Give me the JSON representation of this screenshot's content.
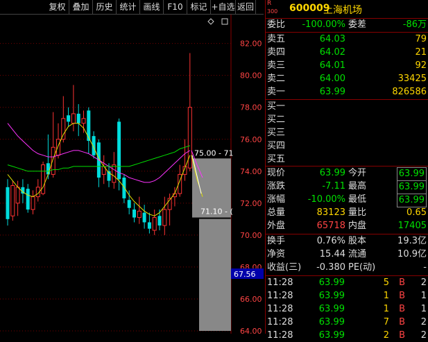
{
  "toolbar": {
    "buttons": [
      "复权",
      "叠加",
      "历史",
      "统计",
      "画线",
      "F10",
      "标记",
      "+自选",
      "返回"
    ]
  },
  "chart_data": {
    "type": "candlestick",
    "title": "",
    "yticks": [
      "82.00",
      "80.00",
      "78.00",
      "76.00",
      "74.00",
      "72.00",
      "70.00",
      "68.00",
      "66.00",
      "64.00"
    ],
    "ylim": [
      64,
      83.2
    ],
    "current_price_label": "67.56",
    "annotation_high": "75.00 - 71",
    "annotation_low": "71.10 - (",
    "candles": [
      {
        "o": 73.0,
        "c": 71.0,
        "h": 73.5,
        "l": 70.6
      },
      {
        "o": 71.2,
        "c": 73.1,
        "h": 73.4,
        "l": 70.9
      },
      {
        "o": 72.0,
        "c": 73.0,
        "h": 73.4,
        "l": 71.2
      },
      {
        "o": 73.0,
        "c": 72.6,
        "h": 73.5,
        "l": 72.0
      },
      {
        "o": 72.9,
        "c": 71.6,
        "h": 73.2,
        "l": 71.4
      },
      {
        "o": 71.6,
        "c": 72.4,
        "h": 72.8,
        "l": 71.3
      },
      {
        "o": 72.4,
        "c": 73.0,
        "h": 73.5,
        "l": 72.1
      },
      {
        "o": 72.6,
        "c": 74.4,
        "h": 74.6,
        "l": 72.5
      },
      {
        "o": 74.5,
        "c": 73.8,
        "h": 76.3,
        "l": 73.5
      },
      {
        "o": 73.8,
        "c": 75.5,
        "h": 77.7,
        "l": 73.6
      },
      {
        "o": 75.0,
        "c": 76.0,
        "h": 77.0,
        "l": 74.8
      },
      {
        "o": 76.0,
        "c": 77.3,
        "h": 78.7,
        "l": 75.8
      },
      {
        "o": 77.5,
        "c": 77.1,
        "h": 78.0,
        "l": 76.8
      },
      {
        "o": 77.0,
        "c": 77.6,
        "h": 79.4,
        "l": 76.5
      },
      {
        "o": 77.6,
        "c": 77.0,
        "h": 78.2,
        "l": 76.2
      },
      {
        "o": 77.0,
        "c": 77.3,
        "h": 77.8,
        "l": 76.4
      },
      {
        "o": 77.8,
        "c": 75.9,
        "h": 78.0,
        "l": 75.1
      },
      {
        "o": 76.2,
        "c": 75.0,
        "h": 76.5,
        "l": 74.8
      },
      {
        "o": 75.8,
        "c": 73.6,
        "h": 76.0,
        "l": 73.0
      },
      {
        "o": 73.8,
        "c": 74.3,
        "h": 75.0,
        "l": 73.2
      },
      {
        "o": 74.0,
        "c": 73.4,
        "h": 74.5,
        "l": 73.0
      },
      {
        "o": 73.3,
        "c": 74.4,
        "h": 75.2,
        "l": 72.9
      },
      {
        "o": 77.1,
        "c": 73.5,
        "h": 77.3,
        "l": 72.8
      },
      {
        "o": 73.6,
        "c": 72.3,
        "h": 73.8,
        "l": 72.0
      },
      {
        "o": 72.2,
        "c": 71.7,
        "h": 72.8,
        "l": 71.3
      },
      {
        "o": 71.6,
        "c": 71.1,
        "h": 72.0,
        "l": 70.8
      },
      {
        "o": 71.1,
        "c": 71.5,
        "h": 72.4,
        "l": 70.7
      },
      {
        "o": 71.4,
        "c": 70.8,
        "h": 71.9,
        "l": 70.4
      },
      {
        "o": 70.8,
        "c": 70.4,
        "h": 71.4,
        "l": 70.1
      },
      {
        "o": 70.3,
        "c": 71.1,
        "h": 71.6,
        "l": 70.0
      },
      {
        "o": 71.2,
        "c": 70.6,
        "h": 71.6,
        "l": 70.3
      },
      {
        "o": 70.6,
        "c": 71.6,
        "h": 72.4,
        "l": 70.0
      },
      {
        "o": 71.6,
        "c": 72.3,
        "h": 72.6,
        "l": 70.6
      },
      {
        "o": 72.4,
        "c": 72.6,
        "h": 73.0,
        "l": 71.8
      },
      {
        "o": 72.6,
        "c": 73.8,
        "h": 74.4,
        "l": 72.4
      },
      {
        "o": 73.8,
        "c": 74.3,
        "h": 76.0,
        "l": 73.4
      },
      {
        "o": 74.2,
        "c": 78.0,
        "h": 81.4,
        "l": 74.0
      }
    ],
    "ma_lines": [
      {
        "color": "#e0e000",
        "values": [
          73.8,
          73.4,
          73.0,
          72.7,
          72.5,
          72.4,
          72.6,
          73.0,
          73.8,
          74.8,
          75.6,
          76.3,
          76.8,
          77.0,
          77.0,
          76.7,
          76.1,
          75.5,
          74.8,
          74.3,
          73.9,
          73.7,
          73.4,
          73.0,
          72.5,
          72.1,
          71.8,
          71.5,
          71.3,
          71.2,
          71.4,
          71.8,
          72.2,
          72.6,
          73.4,
          74.2,
          75.0
        ]
      },
      {
        "color": "#ff33ff",
        "values": [
          77.0,
          76.6,
          76.2,
          75.9,
          75.6,
          75.3,
          75.1,
          75.0,
          74.9,
          74.9,
          75.0,
          75.1,
          75.2,
          75.3,
          75.3,
          75.2,
          75.1,
          74.9,
          74.7,
          74.5,
          74.3,
          74.1,
          73.9,
          73.8,
          73.6,
          73.5,
          73.4,
          73.3,
          73.3,
          73.4,
          73.6,
          73.9,
          74.2,
          74.5,
          74.8,
          75.1,
          75.3
        ]
      },
      {
        "color": "#00e000",
        "values": [
          74.4,
          74.3,
          74.2,
          74.1,
          74.0,
          74.0,
          74.0,
          74.0,
          74.0,
          74.1,
          74.1,
          74.2,
          74.2,
          74.3,
          74.3,
          74.3,
          74.3,
          74.3,
          74.3,
          74.3,
          74.3,
          74.3,
          74.3,
          74.3,
          74.3,
          74.4,
          74.5,
          74.6,
          74.7,
          74.8,
          74.9,
          75.0,
          75.1,
          75.2,
          75.4,
          75.5,
          75.6
        ]
      }
    ],
    "forecast": {
      "yellow": [
        75.0,
        73.5,
        72.4
      ],
      "magenta": [
        75.3,
        74.4,
        73.6
      ]
    },
    "projection_box_top": 74.8,
    "projection_box_break": 71.1,
    "projection_box_bottom": 64.0
  },
  "quote": {
    "r_tag": "R",
    "r_num": "300",
    "code": "600009",
    "name": "上海机场",
    "weibi_label": "委比",
    "weibi_value": "-100.00%",
    "weicha_label": "委差",
    "weicha_value": "-86万",
    "sell": [
      {
        "label": "卖五",
        "price": "64.03",
        "vol": "79"
      },
      {
        "label": "卖四",
        "price": "64.02",
        "vol": "21"
      },
      {
        "label": "卖三",
        "price": "64.01",
        "vol": "92"
      },
      {
        "label": "卖二",
        "price": "64.00",
        "vol": "33425"
      },
      {
        "label": "卖一",
        "price": "63.99",
        "vol": "826586"
      }
    ],
    "buy": [
      {
        "label": "买一"
      },
      {
        "label": "买二"
      },
      {
        "label": "买三"
      },
      {
        "label": "买四"
      },
      {
        "label": "买五"
      }
    ],
    "stats": [
      {
        "l1": "现价",
        "v1": "63.99",
        "c1": "g",
        "l2": "今开",
        "v2": "63.99",
        "c2": "g",
        "box2": true
      },
      {
        "l1": "涨跌",
        "v1": "-7.11",
        "c1": "g",
        "l2": "最高",
        "v2": "63.99",
        "c2": "g",
        "box2": true
      },
      {
        "l1": "涨幅",
        "v1": "-10.00%",
        "c1": "g",
        "l2": "最低",
        "v2": "63.99",
        "c2": "g",
        "box2": true
      },
      {
        "l1": "总量",
        "v1": "83123",
        "c1": "y",
        "l2": "量比",
        "v2": "0.65",
        "c2": "y",
        "box2": false
      },
      {
        "l1": "外盘",
        "v1": "65718",
        "c1": "r",
        "l2": "内盘",
        "v2": "17405",
        "c2": "g",
        "box2": false
      }
    ],
    "stats2": [
      {
        "l1": "换手",
        "v1": "0.76%",
        "l2": "股本",
        "v2": "19.3亿"
      },
      {
        "l1": "净资",
        "v1": "15.44",
        "l2": "流通",
        "v2": "10.9亿"
      },
      {
        "l1": "收益(三)",
        "v1": "-0.380",
        "l2": "PE(动)",
        "v2": "-"
      }
    ],
    "ticks": [
      {
        "time": "11:28",
        "price": "63.99",
        "vol": "5",
        "side": "B",
        "n": "2"
      },
      {
        "time": "11:28",
        "price": "63.99",
        "vol": "1",
        "side": "B",
        "n": "1"
      },
      {
        "time": "11:28",
        "price": "63.99",
        "vol": "1",
        "side": "B",
        "n": "1"
      },
      {
        "time": "11:28",
        "price": "63.99",
        "vol": "7",
        "side": "B",
        "n": "2"
      },
      {
        "time": "11:28",
        "price": "63.99",
        "vol": "2",
        "side": "B",
        "n": "2"
      }
    ]
  }
}
